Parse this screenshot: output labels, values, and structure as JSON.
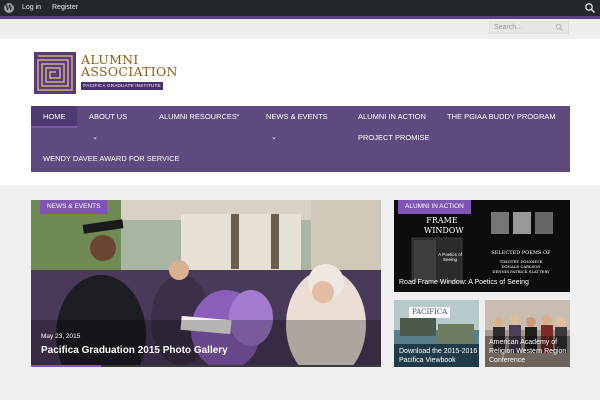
{
  "adminbar": {
    "login": "Log in",
    "register": "Register",
    "wp_icon": "wordpress-icon",
    "search_icon": "search-icon"
  },
  "search": {
    "placeholder": "Search..."
  },
  "logo": {
    "line1": "ALUMNI",
    "line2": "ASSOCIATION",
    "sub": "PACIFICA GRADUATE INSTITUTE"
  },
  "nav": {
    "items": [
      {
        "label": "HOME"
      },
      {
        "label": "ABOUT US"
      },
      {
        "label": "ALUMNI RESOURCES"
      },
      {
        "label": "NEWS & EVENTS"
      },
      {
        "label": "ALUMNI IN ACTION"
      },
      {
        "label": "THE PGIAA BUDDY PROGRAM"
      },
      {
        "label": "PROJECT PROMISE"
      },
      {
        "label": "WENDY DAVEE AWARD FOR SERVICE"
      }
    ]
  },
  "hero": {
    "tag": "NEWS & EVENTS",
    "date": "May 23, 2015",
    "title": "Pacifica Graduation 2015 Photo Gallery"
  },
  "cards": [
    {
      "tag": "ALUMNI IN ACTION",
      "title": "Road Frame Window: A Poetics of Seeing",
      "book_title_1": "FRAME",
      "book_title_2": "WINDOW",
      "book_sub": "A Poetics of Seeing",
      "poems": "SELECTED POEMS OF",
      "authors": "TIMOTHY DONOHUE\nDONALD CARLSON\nDENNIS PATRICK SLATTERY"
    },
    {
      "title": "Download the 2015-2016 Pacifica Viewbook",
      "brand": "PACIFICA"
    },
    {
      "title": "American Academy of Religion Western Region Conference"
    }
  ],
  "colors": {
    "purple": "#5e4a7f",
    "accent": "#7f54b3",
    "adminbar": "#23282d"
  }
}
